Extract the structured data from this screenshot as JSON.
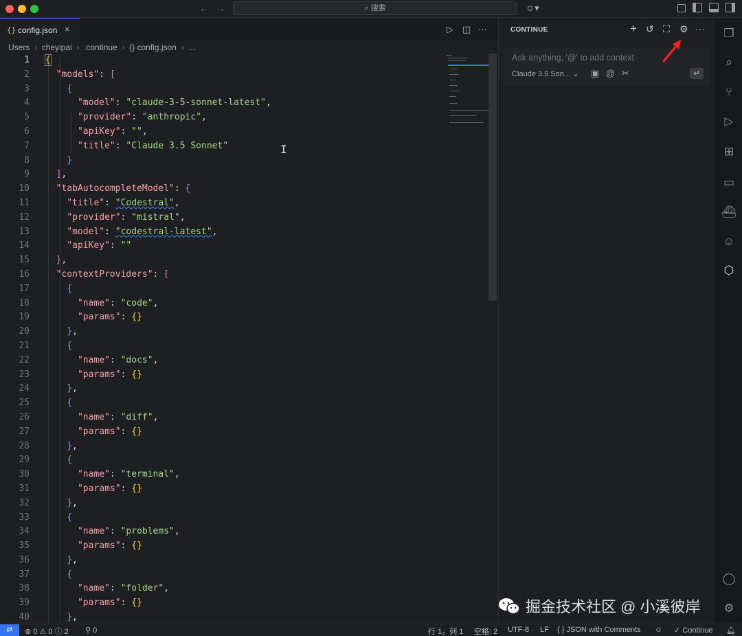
{
  "titlebar": {
    "search_placeholder": "搜索",
    "back": "←",
    "forward": "→"
  },
  "editor": {
    "tab": {
      "icon": "{}",
      "label": "config.json",
      "close": "×"
    },
    "actions": {
      "run": "▷",
      "split": "◫",
      "more": "···"
    },
    "breadcrumb": [
      "Users",
      "cheyipai",
      ".continue",
      "{} config.json",
      "..."
    ],
    "lines": [
      "1",
      "2",
      "3",
      "4",
      "5",
      "6",
      "7",
      "8",
      "9",
      "10",
      "11",
      "12",
      "13",
      "14",
      "15",
      "16",
      "17",
      "18",
      "19",
      "20",
      "21",
      "22",
      "23",
      "24",
      "25",
      "26",
      "27",
      "28",
      "29",
      "30",
      "31",
      "32",
      "33",
      "34",
      "35",
      "36",
      "37",
      "38",
      "39",
      "40"
    ],
    "code": {
      "l2_key": "\"models\"",
      "l4_key": "\"model\"",
      "l4_val": "\"claude-3-5-sonnet-latest\"",
      "l5_key": "\"provider\"",
      "l5_val": "\"anthropic\"",
      "l6_key": "\"apiKey\"",
      "l6_val": "\"\"",
      "l7_key": "\"title\"",
      "l7_val": "\"Claude 3.5 Sonnet\"",
      "l10_key": "\"tabAutocompleteModel\"",
      "l11_key": "\"title\"",
      "l11_val": "\"Codestral\"",
      "l12_key": "\"provider\"",
      "l12_val": "\"mistral\"",
      "l13_key": "\"model\"",
      "l13_val": "\"codestral-latest\"",
      "l14_key": "\"apiKey\"",
      "l14_val": "\"\"",
      "l16_key": "\"contextProviders\"",
      "name_key": "\"name\"",
      "params_key": "\"params\"",
      "code": "\"code\"",
      "docs": "\"docs\"",
      "diff": "\"diff\"",
      "terminal": "\"terminal\"",
      "problems": "\"problems\"",
      "folder": "\"folder\""
    }
  },
  "panel": {
    "title": "CONTINUE",
    "placeholder": "Ask anything, '@' to add context",
    "model": "Claude 3.5 Son...",
    "enter": "↵"
  },
  "watermark": "掘金技术社区 @ 小溪彼岸",
  "statusbar": {
    "errors": "0",
    "warnings": "0",
    "info": "2",
    "ports": "0",
    "position": "行 1，列 1",
    "spaces": "空格: 2",
    "encoding": "UTF-8",
    "eol": "LF",
    "language": "JSON with Comments",
    "continue": "Continue"
  },
  "colors": {
    "accent": "#3574f0",
    "key": "#f2a1a6",
    "string": "#a5d786",
    "arrow": "#ff1f1f"
  },
  "icons": [
    "explorer-icon",
    "search-icon",
    "source-control-icon",
    "run-debug-icon",
    "extensions-icon",
    "remote-explorer-icon",
    "docker-icon",
    "copilot-icon",
    "continue-icon",
    "account-icon",
    "settings-icon"
  ]
}
